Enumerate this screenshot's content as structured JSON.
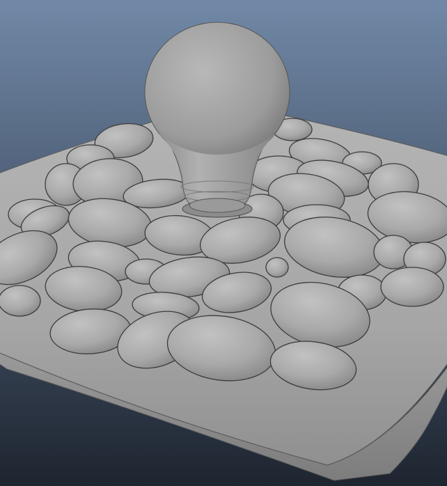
{
  "scene": {
    "background_top": "#7088a6",
    "background_bottom": "#1f2631",
    "surface_color": "#a9a9a9",
    "outline_color": "#3a3a3a",
    "objects": [
      "square-dish",
      "pebbles",
      "light-bulb"
    ]
  }
}
